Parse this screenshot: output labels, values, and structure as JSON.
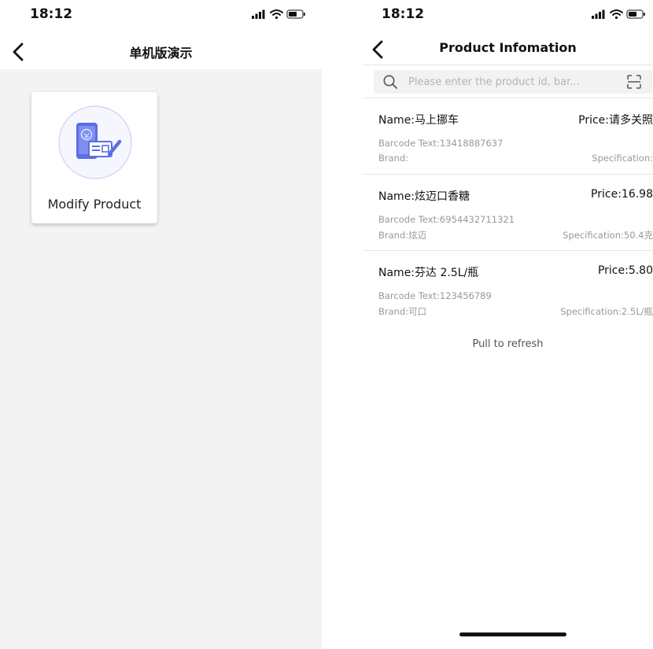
{
  "left_screen": {
    "status_time": "18:12",
    "title": "单机版演示",
    "card": {
      "label": "Modify Product",
      "icon": "product-edit-icon"
    }
  },
  "right_screen": {
    "status_time": "18:12",
    "title": "Product Infomation",
    "search": {
      "placeholder": "Please enter the product id, bar...",
      "value": ""
    },
    "products": [
      {
        "name": "Name:马上挪车",
        "price": "Price:请多关照",
        "barcode": "Barcode Text:13418887637",
        "brand": "Brand:",
        "spec": "Specification:"
      },
      {
        "name": "Name:炫迈口香糖",
        "price": "Price:16.98",
        "barcode": "Barcode Text:6954432711321",
        "brand": "Brand:炫迈",
        "spec": "Specification:50.4克"
      },
      {
        "name": "Name:芬达 2.5L/瓶",
        "price": "Price:5.80",
        "barcode": "Barcode Text:123456789",
        "brand": "Brand:可口",
        "spec": "Specification:2.5L/瓶"
      }
    ],
    "pull_refresh": "Pull to refresh"
  }
}
